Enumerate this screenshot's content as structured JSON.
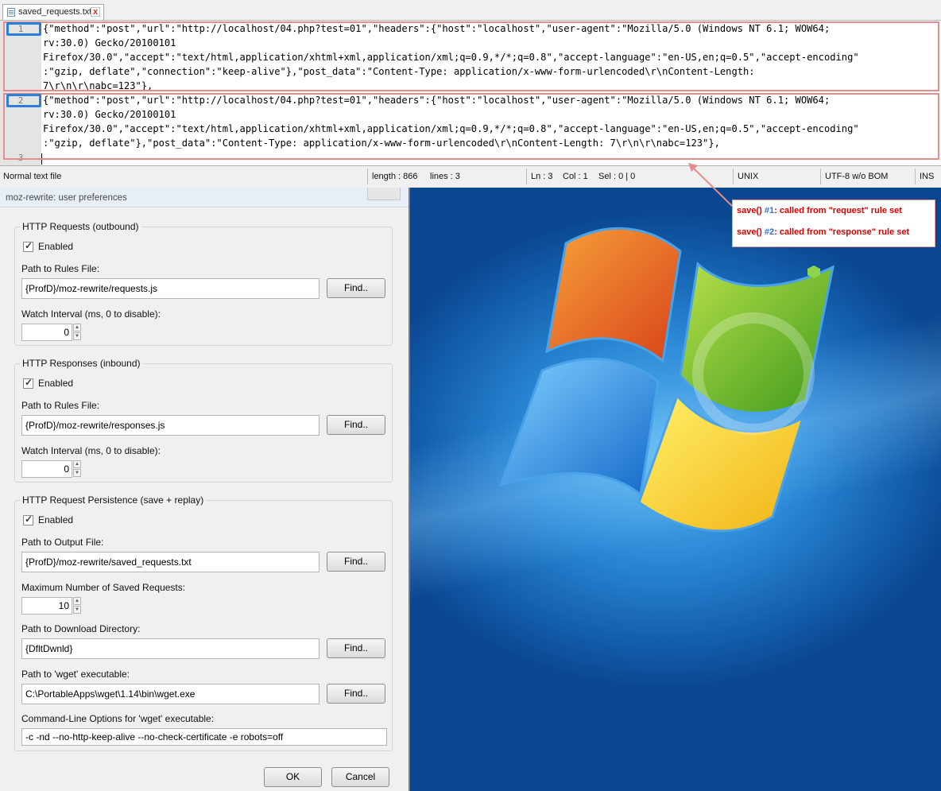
{
  "editor": {
    "tab": {
      "filename": "saved_requests.txt",
      "close_glyph": "x"
    },
    "lines": [
      {
        "number": "1",
        "text": [
          "{\"method\":\"post\",\"url\":\"http://localhost/04.php?test=01\",\"headers\":{\"host\":\"localhost\",\"user-agent\":\"Mozilla/5.0 (Windows NT 6.1; WOW64;",
          "rv:30.0) Gecko/20100101",
          "Firefox/30.0\",\"accept\":\"text/html,application/xhtml+xml,application/xml;q=0.9,*/*;q=0.8\",\"accept-language\":\"en-US,en;q=0.5\",\"accept-encoding\"",
          ":\"gzip, deflate\",\"connection\":\"keep-alive\"},\"post_data\":\"Content-Type: application/x-www-form-urlencoded\\r\\nContent-Length:",
          "7\\r\\n\\r\\nabc=123\"},"
        ]
      },
      {
        "number": "2",
        "text": [
          "{\"method\":\"post\",\"url\":\"http://localhost/04.php?test=01\",\"headers\":{\"host\":\"localhost\",\"user-agent\":\"Mozilla/5.0 (Windows NT 6.1; WOW64;",
          "rv:30.0) Gecko/20100101",
          "Firefox/30.0\",\"accept\":\"text/html,application/xhtml+xml,application/xml;q=0.9,*/*;q=0.8\",\"accept-language\":\"en-US,en;q=0.5\",\"accept-encoding\"",
          ":\"gzip, deflate\"},\"post_data\":\"Content-Type: application/x-www-form-urlencoded\\r\\nContent-Length: 7\\r\\n\\r\\nabc=123\"},"
        ]
      },
      {
        "number": "3",
        "text": []
      }
    ],
    "status": {
      "file_type": "Normal text file",
      "length": "length : 866",
      "lines": "lines : 3",
      "ln": "Ln : 3",
      "col": "Col : 1",
      "sel": "Sel : 0 | 0",
      "eol": "UNIX",
      "encoding": "UTF-8 w/o BOM",
      "mode": "INS"
    }
  },
  "callout": {
    "line1": {
      "pre": "save() ",
      "num": "#1",
      "post": ": called from \"request\" rule set"
    },
    "line2": {
      "pre": "save() ",
      "num": "#2",
      "post": ": called from \"response\" rule set"
    }
  },
  "dialog": {
    "title": "moz-rewrite: user preferences",
    "http_requests": {
      "title": "HTTP Requests (outbound)",
      "enabled_label": "Enabled",
      "rules_label": "Path to Rules File:",
      "rules_value": "{ProfD}/moz-rewrite/requests.js",
      "find_label": "Find..",
      "interval_label": "Watch Interval (ms, 0 to disable):",
      "interval_value": "0"
    },
    "http_responses": {
      "title": "HTTP Responses (inbound)",
      "enabled_label": "Enabled",
      "rules_label": "Path to Rules File:",
      "rules_value": "{ProfD}/moz-rewrite/responses.js",
      "find_label": "Find..",
      "interval_label": "Watch Interval (ms, 0 to disable):",
      "interval_value": "0"
    },
    "persistence": {
      "title": "HTTP Request Persistence (save + replay)",
      "enabled_label": "Enabled",
      "output_label": "Path to Output File:",
      "output_value": "{ProfD}/moz-rewrite/saved_requests.txt",
      "find_label": "Find..",
      "max_label": "Maximum Number of Saved Requests:",
      "max_value": "10",
      "download_label": "Path to Download Directory:",
      "download_value": "{DfltDwnld}",
      "wget_label": "Path to 'wget' executable:",
      "wget_value": "C:\\PortableApps\\wget\\1.14\\bin\\wget.exe",
      "cmd_label": "Command-Line Options for 'wget' executable:",
      "cmd_value": "-c -nd --no-http-keep-alive --no-check-certificate -e robots=off"
    },
    "ok_label": "OK",
    "cancel_label": "Cancel"
  },
  "colors": {
    "annotation_box": "#e58c8c",
    "line_number_box": "#2b7fd6",
    "callout_text": "#d40000",
    "desktop_blue": "#1a5fa8"
  },
  "icons": [
    "text-file-icon",
    "close-tab-icon",
    "checkbox-icon",
    "spinner-up-icon",
    "spinner-down-icon",
    "windows-logo-icon"
  ]
}
